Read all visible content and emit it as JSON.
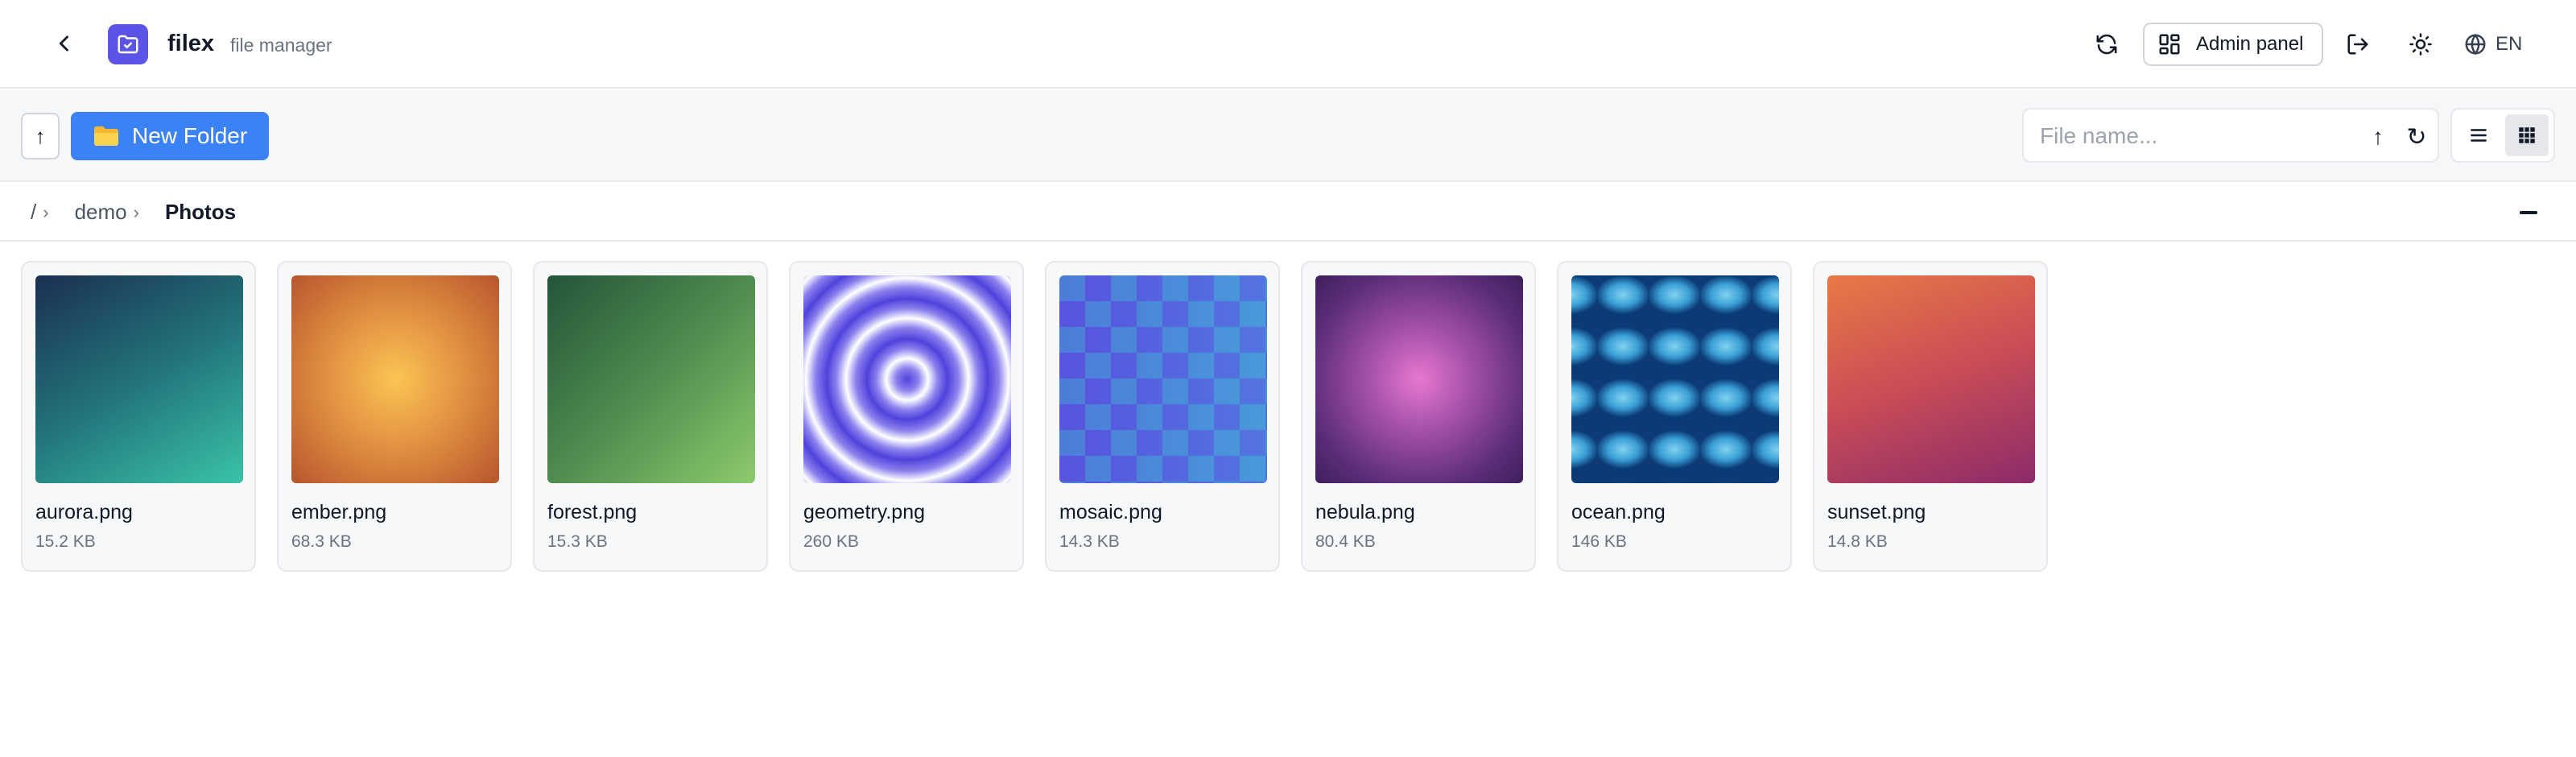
{
  "header": {
    "app_name": "filex",
    "app_subtitle": "file manager",
    "admin_label": "Admin panel",
    "lang_label": "EN"
  },
  "toolbar": {
    "up_label": "↑",
    "new_folder_label": "New Folder",
    "search_placeholder": "File name...",
    "search_value": "",
    "sort_label": "↑",
    "reload_label": "↻"
  },
  "breadcrumb": {
    "root": "/",
    "items": [
      "demo"
    ],
    "current": "Photos",
    "separator": "›"
  },
  "files": [
    {
      "name": "aurora.png",
      "size": "15.2 KB"
    },
    {
      "name": "ember.png",
      "size": "68.3 KB"
    },
    {
      "name": "forest.png",
      "size": "15.3 KB"
    },
    {
      "name": "geometry.png",
      "size": "260 KB"
    },
    {
      "name": "mosaic.png",
      "size": "14.3 KB"
    },
    {
      "name": "nebula.png",
      "size": "80.4 KB"
    },
    {
      "name": "ocean.png",
      "size": "146 KB"
    },
    {
      "name": "sunset.png",
      "size": "14.8 KB"
    }
  ],
  "colors": {
    "accent": "#3b82f6",
    "logo": "#5b54e6"
  }
}
